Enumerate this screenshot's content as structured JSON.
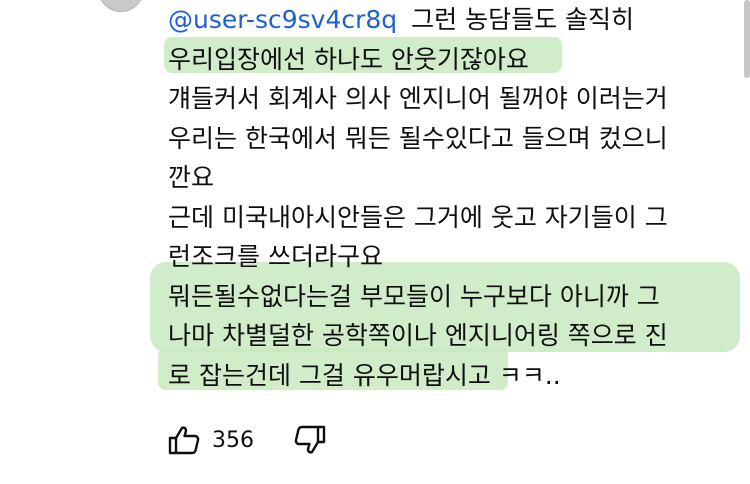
{
  "comment": {
    "author_handle": "@user-sc9sv4cr8q",
    "lines": [
      "그런 농담들도 솔직히",
      "우리입장에선 하나도 안웃기잖아요",
      "걔들커서 회계사 의사 엔지니어 될꺼야 이러는거",
      "우리는 한국에서 뭐든 될수있다고 들으며 컸으니",
      "깐요",
      "근데 미국내아시안들은 그거에 웃고 자기들이 그",
      "런조크를 쓰더라구요",
      "뭐든될수없다는걸 부모들이 누구보다 아니까 그",
      "나마 차별덜한 공학쪽이나 엔지니어링 쪽으로 진",
      "로 잡는건데 그걸 유우머랍시고",
      "ㅋㅋ.."
    ],
    "highlight_color": "#c9e9c0",
    "handle_color": "#1d5fd4"
  },
  "actions": {
    "like_count": "356",
    "like_icon": "thumb-up-icon",
    "dislike_icon": "thumb-down-icon"
  }
}
